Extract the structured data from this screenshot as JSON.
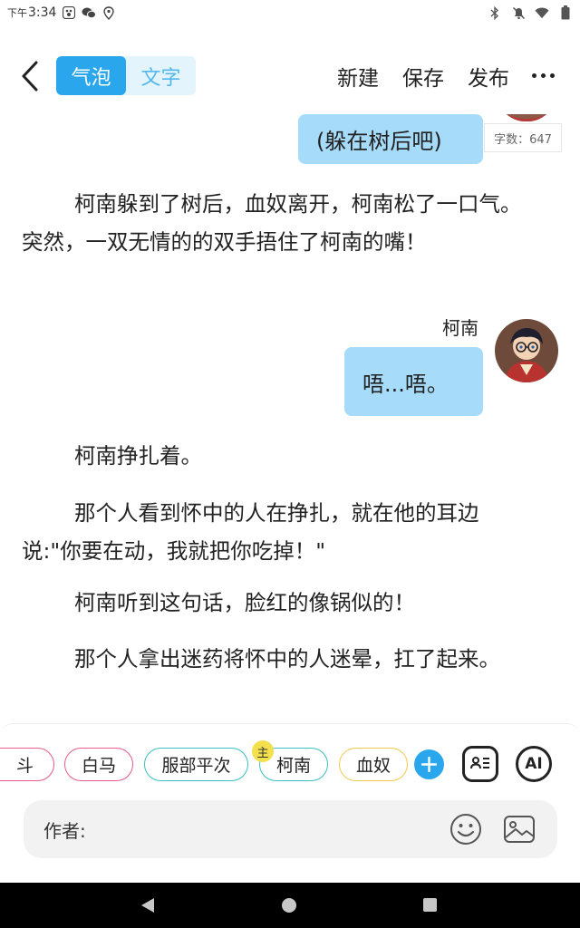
{
  "status_bar": {
    "time_prefix": "下午",
    "time": "3:34"
  },
  "toolbar": {
    "mode_tabs": [
      {
        "label": "气泡",
        "active": true
      },
      {
        "label": "文字",
        "active": false
      }
    ],
    "new_label": "新建",
    "save_label": "保存",
    "publish_label": "发布",
    "more_icon": "more-dots-icon",
    "accent_color": "#2aa7ec"
  },
  "content": {
    "top_bubble": "(躲在树后吧)",
    "word_count": "字数：647",
    "paragraph_1": "柯南躲到了树后，血奴离开，柯南松了一口气。突然，一双无情的的双手捂住了柯南的嘴！",
    "speaker_name": "柯南",
    "speaker_bubble": "唔...唔。",
    "paragraph_2": "柯南挣扎着。",
    "paragraph_3": "那个人看到怀中的人在挣扎，就在他的耳边说:\"你要在动，我就把你吃掉！\"",
    "paragraph_4": "柯南听到这句话，脸红的像锅似的！",
    "paragraph_5": "那个人拿出迷药将怀中的人迷晕，扛了起来。",
    "bubble_color": "#a6dbfa"
  },
  "characters": {
    "items": [
      {
        "label": "斗",
        "color": "#e85a8c"
      },
      {
        "label": "白马",
        "color": "#e85a8c"
      },
      {
        "label": "服部平次",
        "color": "#3bbfc0"
      },
      {
        "label": "柯南",
        "color": "#3bbfc0"
      },
      {
        "label": "血奴",
        "color": "#f2c94c"
      }
    ],
    "main_badge": "主"
  },
  "input": {
    "author_label": "作者:",
    "ai_label": "AI"
  }
}
